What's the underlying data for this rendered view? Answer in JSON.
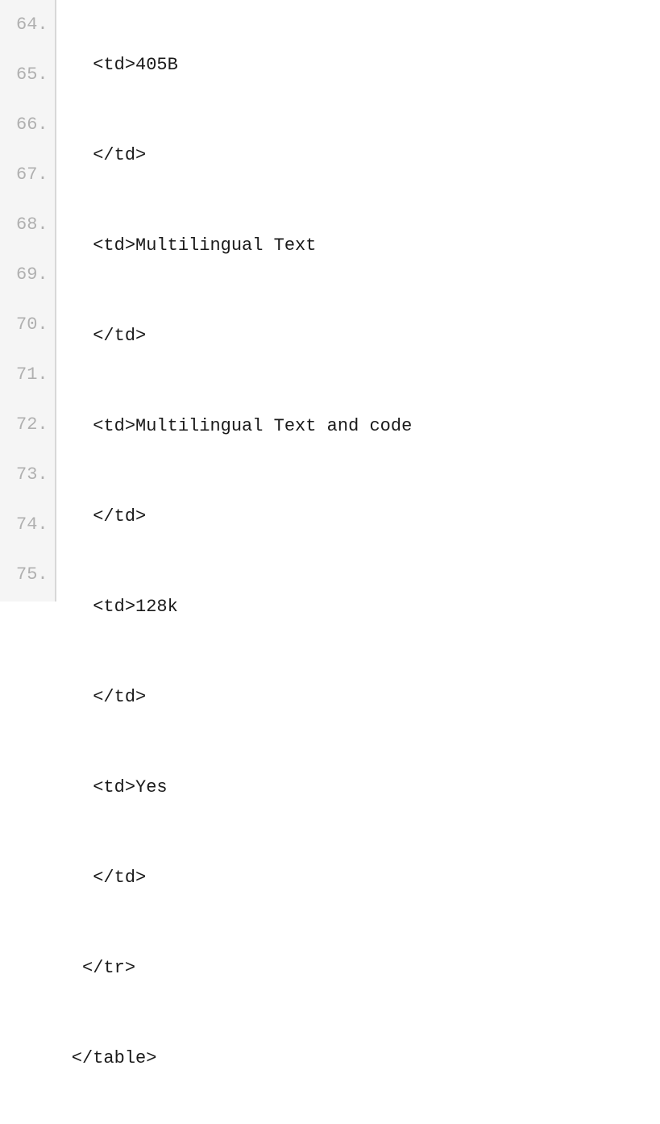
{
  "editor": {
    "startLine": 64,
    "lines": [
      {
        "num": "64",
        "text": "   <td>405B"
      },
      {
        "num": "65",
        "text": "   </td>"
      },
      {
        "num": "66",
        "text": "   <td>Multilingual Text"
      },
      {
        "num": "67",
        "text": "   </td>"
      },
      {
        "num": "68",
        "text": "   <td>Multilingual Text and code"
      },
      {
        "num": "69",
        "text": "   </td>"
      },
      {
        "num": "70",
        "text": "   <td>128k"
      },
      {
        "num": "71",
        "text": "   </td>"
      },
      {
        "num": "72",
        "text": "   <td>Yes"
      },
      {
        "num": "73",
        "text": "   </td>"
      },
      {
        "num": "74",
        "text": "  </tr>"
      },
      {
        "num": "75",
        "text": " </table>"
      }
    ]
  }
}
